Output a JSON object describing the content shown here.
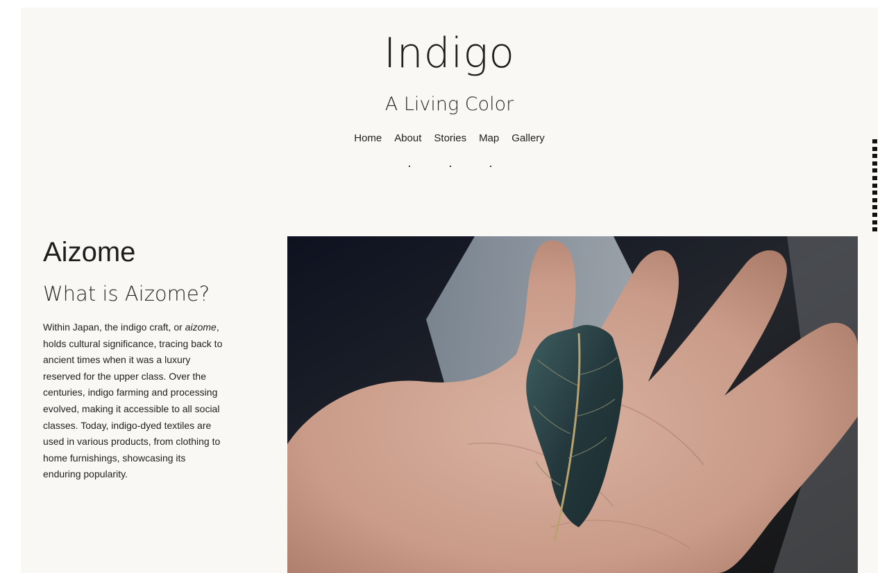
{
  "site": {
    "title": "Indigo",
    "subtitle": "A Living Color"
  },
  "nav": {
    "items": [
      "Home",
      "About",
      "Stories",
      "Map",
      "Gallery"
    ]
  },
  "section": {
    "title": "Aizome",
    "subtitle": "What is Aizome?",
    "body_before": "Within Japan, the indigo craft, or ",
    "body_emphasis": "aizome",
    "body_after": ", holds cultural significance, tracing back to ancient times when it was a luxury reserved for the upper class. Over the centuries, indigo farming and processing evolved, making it accessible to all social classes. Today, indigo-dyed textiles are used in various products, from clothing to home furnishings, showcasing its enduring popularity."
  },
  "colors": {
    "page_background": "#faf8f5",
    "text": "#1e1e1e"
  }
}
